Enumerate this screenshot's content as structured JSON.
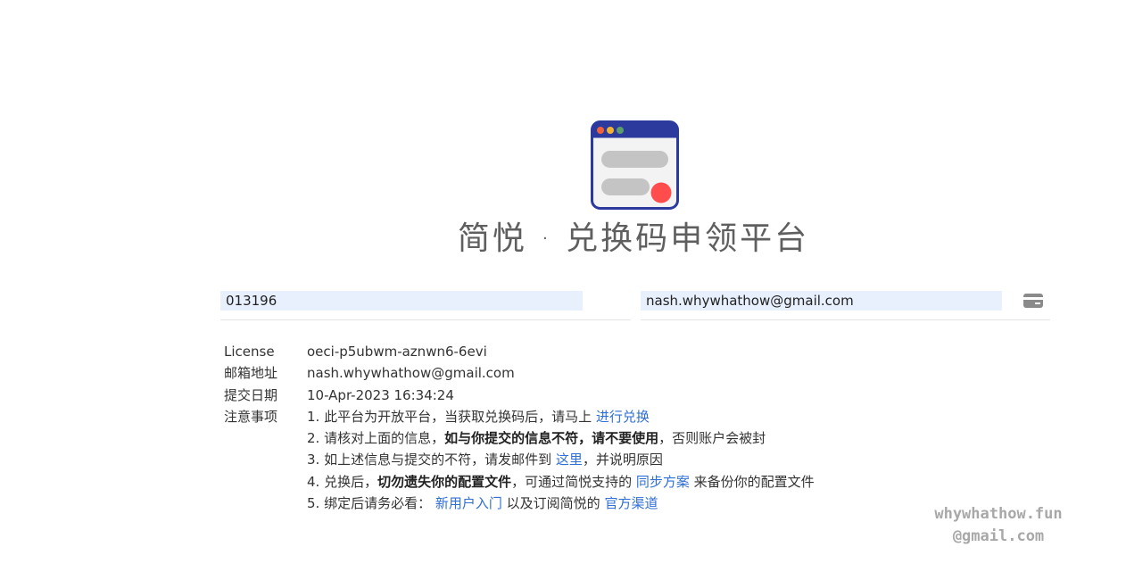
{
  "header": {
    "title": "简悦 · 兑换码申领平台"
  },
  "form": {
    "code_value": "013196",
    "email_value": "nash.whywhathow@gmail.com",
    "card_icon": "credit-card-icon"
  },
  "info": {
    "license_label": "License",
    "license_value": "oeci-p5ubwm-aznwn6-6evi",
    "email_label": "邮箱地址",
    "email_value": "nash.whywhathow@gmail.com",
    "date_label": "提交日期",
    "date_value": "10-Apr-2023 16:34:24",
    "notes_label": "注意事项"
  },
  "notes": {
    "n1_text": "1. 此平台为开放平台，当获取兑换码后，请马上 ",
    "n1_link": "进行兑换",
    "n2_text": "2. 请核对上面的信息，",
    "n2_bold": "如与你提交的信息不符，请不要使用",
    "n2_tail": "，否则账户会被封",
    "n3_text": "3. 如上述信息与提交的不符，请发邮件到 ",
    "n3_link": "这里",
    "n3_tail": "，并说明原因",
    "n4_text": "4. 兑换后，",
    "n4_bold": "切勿遗失你的配置文件",
    "n4_mid": "，可通过简悦支持的 ",
    "n4_link": "同步方案",
    "n4_tail": " 来备份你的配置文件",
    "n5_text": "5. 绑定后请务必看：",
    "n5_link1": "新用户入门",
    "n5_mid": " 以及订阅简悦的 ",
    "n5_link2": "官方渠道"
  },
  "watermark": {
    "line1": "whywhathow.fun",
    "line2": "@gmail.com"
  },
  "colors": {
    "link": "#2f6fd6",
    "logo_frame": "#2b3a9c",
    "logo_dot_red": "#ff4d4d",
    "input_bg": "#e8f0fe"
  }
}
